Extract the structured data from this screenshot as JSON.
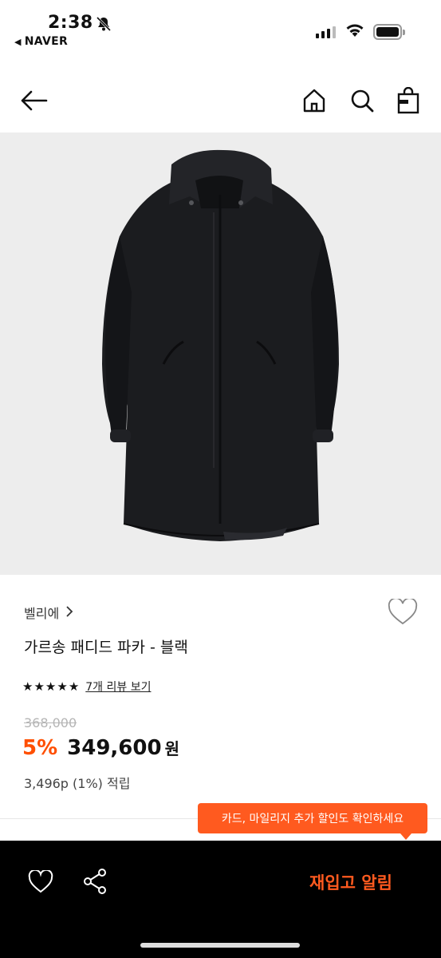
{
  "status_bar": {
    "time": "2:38",
    "back_app": "NAVER"
  },
  "product": {
    "brand": "벨리에",
    "title": "가르송 패디드 파카 - 블랙",
    "rating_stars": 5,
    "review_link": "7개 리뷰 보기",
    "original_price": "368,000",
    "discount": "5%",
    "price": "349,600",
    "currency": "원",
    "points": "3,496p (1%) 적립"
  },
  "tooltip": {
    "text": "카드, 마일리지 추가 할인도 확인하세요"
  },
  "bottom_bar": {
    "restock_label": "재입고 알림"
  },
  "colors": {
    "accent": "#ff5a1f",
    "image_bg": "#ededed",
    "bottom_bar_bg": "#000000"
  },
  "icons": {
    "header": [
      "back-arrow-icon",
      "home-icon",
      "search-icon",
      "shopping-bag-icon"
    ],
    "bottom": [
      "heart-icon",
      "share-icon"
    ]
  }
}
